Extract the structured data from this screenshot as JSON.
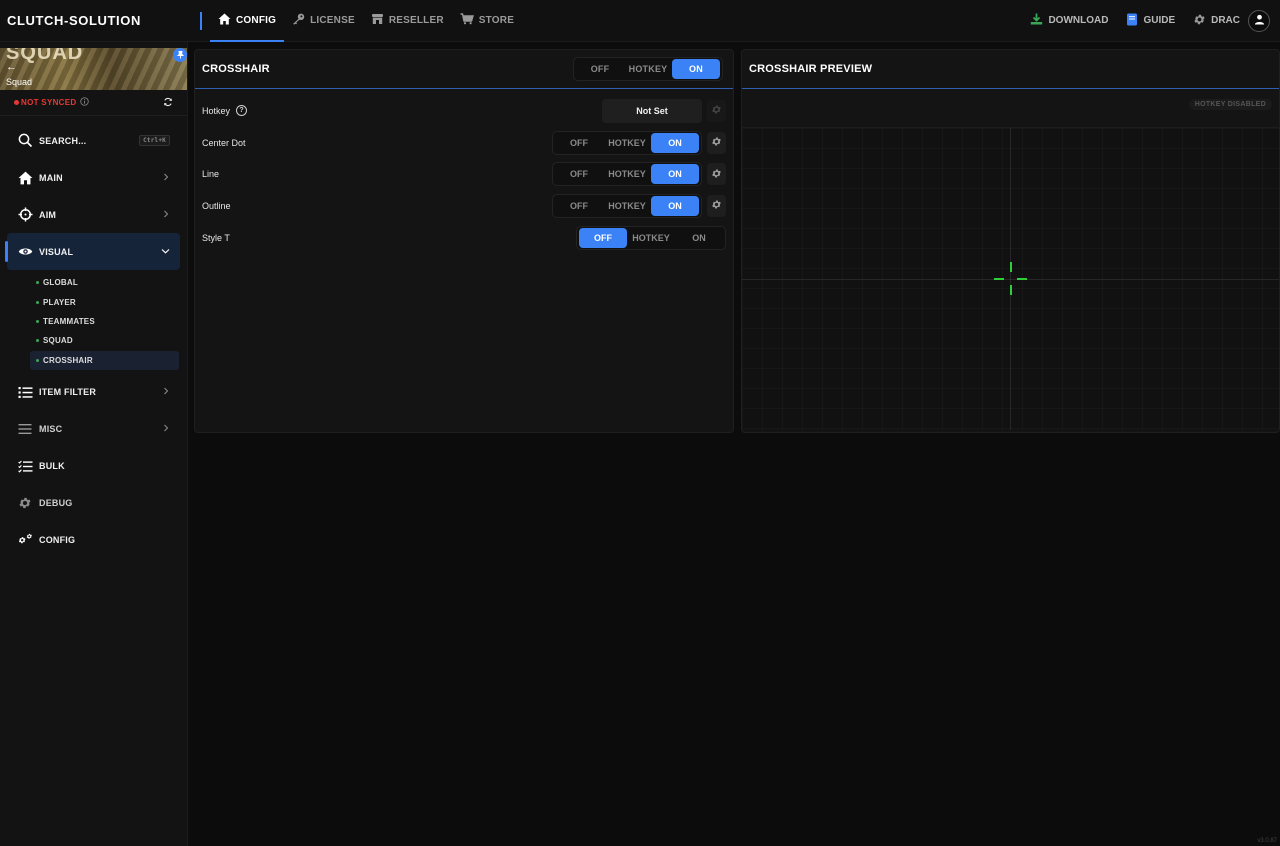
{
  "brand": "CLUTCH-SOLUTION",
  "topnav": [
    {
      "label": "CONFIG",
      "icon": "home-icon",
      "active": true
    },
    {
      "label": "LICENSE",
      "icon": "key-icon",
      "active": false
    },
    {
      "label": "RESELLER",
      "icon": "store-icon",
      "active": false
    },
    {
      "label": "STORE",
      "icon": "cart-icon",
      "active": false
    }
  ],
  "topright": {
    "download": "DOWNLOAD",
    "guide": "GUIDE",
    "user": "DRAC"
  },
  "game": {
    "banner_text": "SQUAD",
    "name": "Squad"
  },
  "sync": {
    "status": "NOT SYNCED",
    "status_color": "#e53935"
  },
  "sidebar": {
    "search": {
      "label": "SEARCH...",
      "shortcut": "Ctrl+K"
    },
    "items": [
      {
        "label": "MAIN",
        "icon": "home-icon",
        "expandable": true
      },
      {
        "label": "AIM",
        "icon": "crosshair-icon",
        "expandable": true
      },
      {
        "label": "VISUAL",
        "icon": "eye-icon",
        "expandable": true,
        "active": true
      },
      {
        "label": "ITEM FILTER",
        "icon": "list-icon",
        "expandable": true
      },
      {
        "label": "MISC",
        "icon": "menu-icon",
        "expandable": true
      },
      {
        "label": "BULK",
        "icon": "checklist-icon",
        "expandable": false
      },
      {
        "label": "DEBUG",
        "icon": "gear-icon",
        "expandable": false
      },
      {
        "label": "CONFIG",
        "icon": "gears-icon",
        "expandable": false
      }
    ],
    "visual_sub": [
      "GLOBAL",
      "PLAYER",
      "TEAMMATES",
      "SQUAD",
      "CROSSHAIR"
    ],
    "active_sub": "CROSSHAIR"
  },
  "crosshair_panel": {
    "title": "CROSSHAIR",
    "toggle": {
      "options": [
        "OFF",
        "HOTKEY",
        "ON"
      ],
      "selected": "ON"
    },
    "hotkey": {
      "label": "Hotkey",
      "value": "Not Set"
    },
    "rows": [
      {
        "label": "Center Dot",
        "options": [
          "OFF",
          "HOTKEY",
          "ON"
        ],
        "selected": "ON",
        "has_settings": true
      },
      {
        "label": "Line",
        "options": [
          "OFF",
          "HOTKEY",
          "ON"
        ],
        "selected": "ON",
        "has_settings": true
      },
      {
        "label": "Outline",
        "options": [
          "OFF",
          "HOTKEY",
          "ON"
        ],
        "selected": "ON",
        "has_settings": true
      },
      {
        "label": "Style T",
        "options": [
          "OFF",
          "HOTKEY",
          "ON"
        ],
        "selected": "OFF",
        "has_settings": false
      }
    ]
  },
  "preview_panel": {
    "title": "CROSSHAIR PREVIEW",
    "badge": "HOTKEY DISABLED",
    "crosshair_color": "#2fcf3a"
  },
  "accent_color": "#3b82f6",
  "version": "v3.0.87"
}
